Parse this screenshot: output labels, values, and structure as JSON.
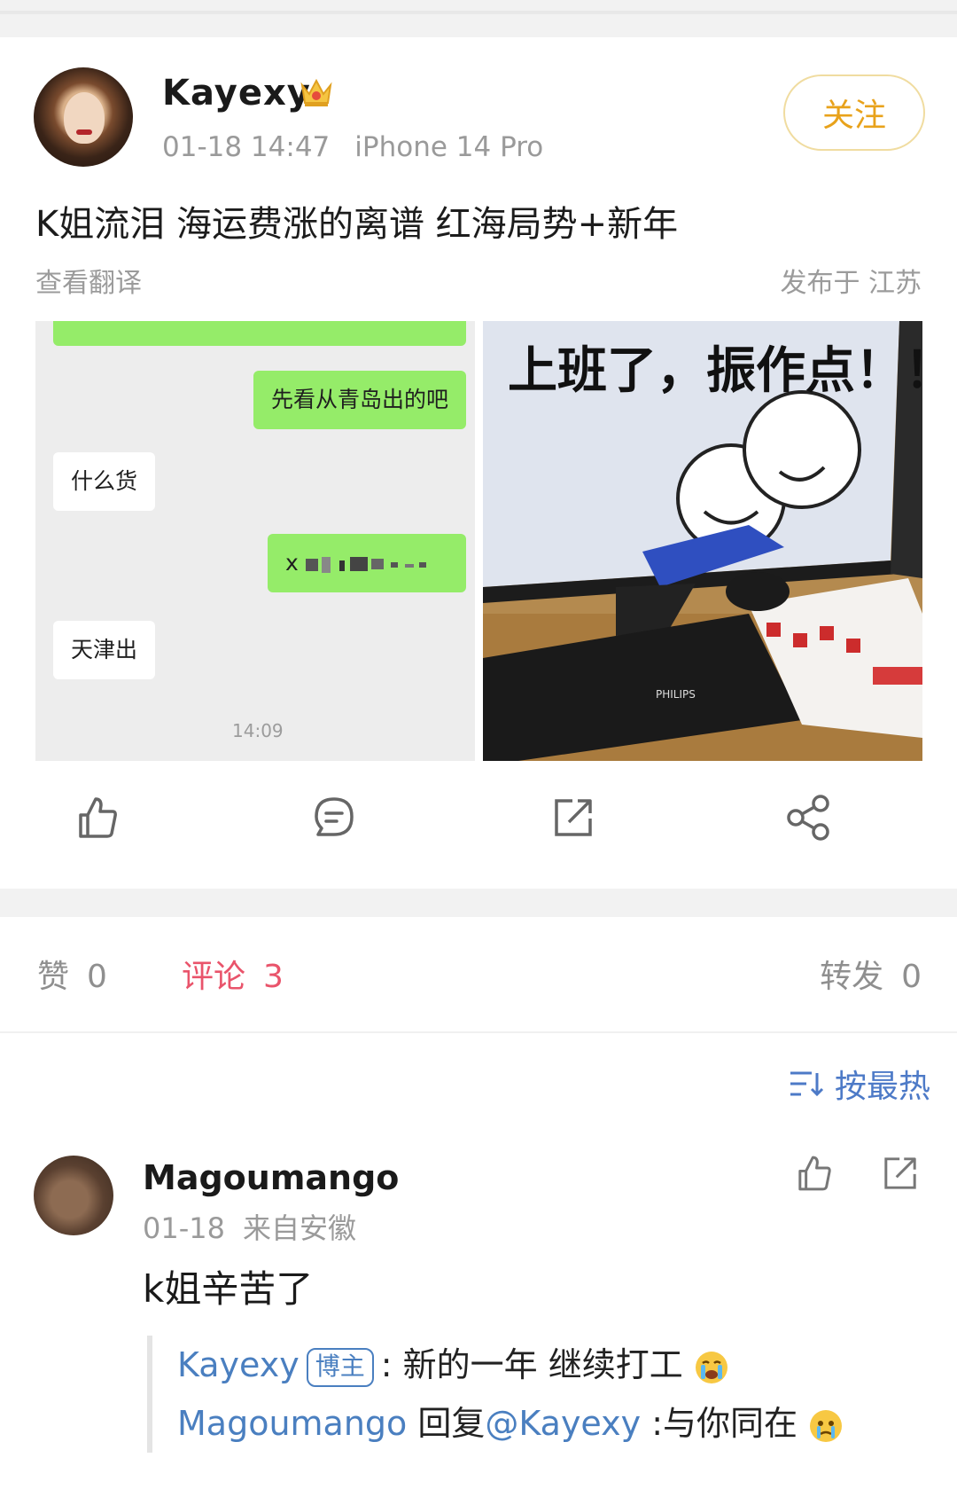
{
  "post": {
    "username": "Kayexy",
    "date": "01-18 14:47",
    "device": "iPhone 14 Pro",
    "follow_label": "关注",
    "text": "K姐流泪 海运费涨的离谱 红海局势+新年",
    "translate_label": "查看翻译",
    "location_label": "发布于 江苏",
    "chat_image": {
      "messages": [
        {
          "side": "right",
          "text": "先看从青岛出的吧"
        },
        {
          "side": "left",
          "text": "什么货"
        },
        {
          "side": "right",
          "text": "x"
        },
        {
          "side": "left",
          "text": "天津出"
        }
      ],
      "time": "14:09"
    },
    "desk_image": {
      "caption": "上班了，振作点！！！",
      "keyboard_brand": "PHILIPS"
    }
  },
  "actions": {
    "like_icon": "thumb-up-icon",
    "comment_icon": "comment-icon",
    "repost_icon": "repost-icon",
    "share_icon": "share-icon"
  },
  "stats": {
    "likes_label": "赞",
    "likes_count": "0",
    "comments_label": "评论",
    "comments_count": "3",
    "reposts_label": "转发",
    "reposts_count": "0"
  },
  "sort": {
    "label": "按最热",
    "icon": "sort-icon"
  },
  "comment": {
    "username": "Magoumango",
    "date": "01-18",
    "source": "来自安徽",
    "text": "k姐辛苦了",
    "replies": [
      {
        "user": "Kayexy",
        "badge": "博主",
        "sep": ":",
        "text": "新的一年 继续打工"
      },
      {
        "user": "Magoumango",
        "reply_label": "回复",
        "mention": "@Kayexy",
        "sep": ":",
        "text": "与你同在"
      }
    ]
  },
  "colors": {
    "accent_follow": "#e8a21b",
    "active_tab": "#e9546b",
    "link_blue": "#4a7fc0",
    "wechat_green": "#95ec69"
  }
}
